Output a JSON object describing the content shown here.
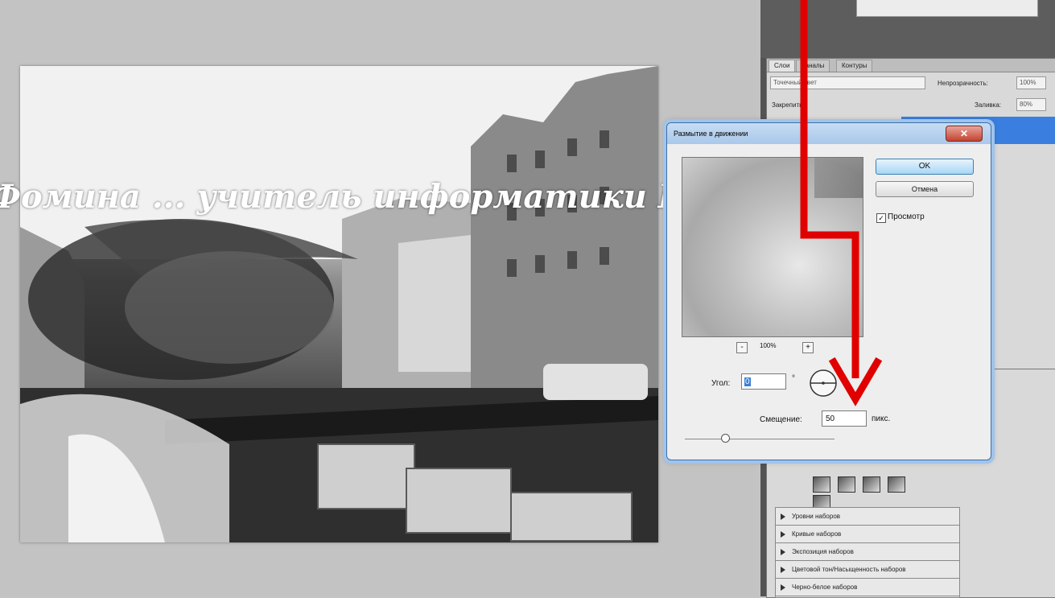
{
  "layers_panel": {
    "tabs": [
      "Слои",
      "Каналы",
      "Контуры"
    ],
    "blend_mode": "Точечный свет",
    "opacity_label": "Непрозрачность:",
    "opacity_value": "100%",
    "lock_label": "Закрепить:",
    "fill_label": "Заливка:",
    "fill_value": "80%"
  },
  "dialog": {
    "title": "Размытие в движении",
    "close_symbol": "✕",
    "ok_label": "OK",
    "cancel_label": "Отмена",
    "preview_label": "Просмотр",
    "preview_checked_mark": "✓",
    "zoom_minus": "-",
    "zoom_plus": "+",
    "zoom_value": "100%",
    "angle_label": "Угол:",
    "angle_value": "0",
    "degree_sign": "°",
    "offset_label": "Смещение:",
    "offset_value": "50",
    "offset_unit": "пикс.",
    "offset_slider_fraction": 0.27
  },
  "adjustments_panel": {
    "items": [
      "Уровни наборов",
      "Кривые наборов",
      "Экспозиция наборов",
      "Цветовой тон/Насыщенность наборов",
      "Черно-белое наборов"
    ]
  },
  "watermark_text": "Фомина ... учитель информатики ГБОУ шк.№",
  "colors": {
    "annotation_arrow": "#e10000",
    "selection": "#3a7fe0",
    "dialog_border": "#9fc4ec"
  }
}
